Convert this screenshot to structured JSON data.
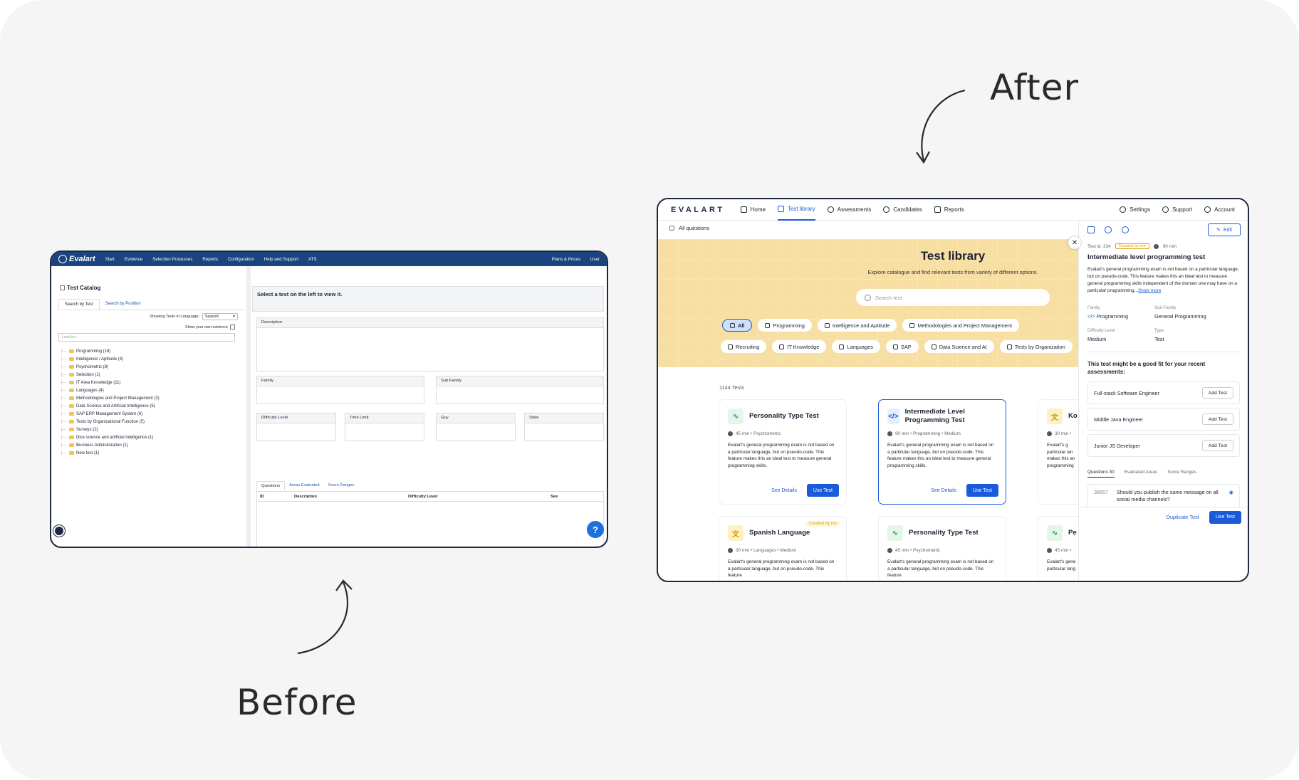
{
  "labels": {
    "after": "After",
    "before": "Before"
  },
  "before": {
    "nav": {
      "logo": "Evalart",
      "items": [
        "Start",
        "Evidence",
        "Selection Processes",
        "Reports",
        "Configuration",
        "Help and Support",
        "ATS"
      ],
      "right_items": [
        "Plans & Prices",
        "User"
      ]
    },
    "title": "Test Catalog",
    "tabs": [
      "Search by Test",
      "Search by Position"
    ],
    "language_label": "Showing Tests in Language:",
    "language_value": "Spanish",
    "own_evidence_label": "Show your own evidence",
    "look_for_placeholder": "Look for...",
    "tree": [
      "Programming (18)",
      "Intelligence / Aptitude (4)",
      "Psychometric (8)",
      "Selection (1)",
      "IT Area Knowledge (11)",
      "Languages (4)",
      "Methodologies and Project Management (3)",
      "Data Science and Artificial Intelligence (5)",
      "SAP ERP Management System (6)",
      "Tests by Organizational Function (5)",
      "Surveys (2)",
      "Dice science and artificial intelligence (1)",
      "Business Administration (1)",
      "New test (1)"
    ],
    "right_header": "Select a test on the left to view it.",
    "fields": {
      "description": "Description",
      "family": "Family",
      "sub_family": "Sub Family",
      "difficulty": "Difficulty Level",
      "time_limit": "Time Limit",
      "guy": "Guy",
      "state": "State"
    },
    "question_tabs": [
      "Questions",
      "Areas Evaluated",
      "Score Ranges"
    ],
    "table_headers": [
      "ID",
      "Description",
      "Difficulty Level",
      "See"
    ],
    "help": "?"
  },
  "after": {
    "nav": {
      "logo": "EVALART",
      "items": [
        "Home",
        "Test library",
        "Assessments",
        "Candidates",
        "Reports"
      ],
      "right_items": [
        "Settings",
        "Support",
        "Account"
      ]
    },
    "breadcrumb": "All questions",
    "hero": {
      "title": "Test library",
      "subtitle": "Explore catalogue and find relevant tests from variety of different options.",
      "search_placeholder": "Search test"
    },
    "chips_row1": [
      "All",
      "Programming",
      "Intelligence and Aptitude",
      "Methodologies and Project Management"
    ],
    "chips_row2": [
      "Recruiting",
      "IT Knowledge",
      "Languages",
      "SAP",
      "Data Science and AI",
      "Tests by Organization"
    ],
    "count": "1144 Tests",
    "cards": [
      {
        "title": "Personality Type Test",
        "meta": "45 min  •  Psychometric",
        "desc": "Evalart's general programming exam is not based on a particular language, but on pseudo-code. This feature makes this an ideal test to measure general programming skills.",
        "details": "See Details",
        "use": "Use Test"
      },
      {
        "title": "Intermediate Level Programming Test",
        "meta": "90 min  •  Programming  •  Medium",
        "desc": "Evalart's general programming exam is not based on a particular language, but on pseudo-code. This feature makes this an ideal test to measure general programming skills.",
        "details": "See Details",
        "use": "Use Test"
      },
      {
        "title": "Ko",
        "meta": "30 min  •",
        "desc": "Evalart's g particular lan makes this an programming"
      },
      {
        "title": "Spanish Language",
        "meta": "30 min  •  Languages  •  Medium",
        "desc": "Evalart's general programming exam is not based on a particular language, but on pseudo-code. This feature",
        "badge": "Created by me"
      },
      {
        "title": "Personality Type Test",
        "meta": "45 min  •  Psychometric",
        "desc": "Evalart's general programming exam is not based on a particular language, but on pseudo-code. This feature"
      },
      {
        "title": "Pe",
        "meta": "45 min  •",
        "desc": "Evalart's gene particular lang"
      }
    ],
    "panel": {
      "edit": "Edit",
      "test_id": "Test id: 334",
      "badge": "Created by me",
      "duration": "90 min",
      "title": "Intermediate level programming test",
      "desc": "Evalart's general programming exam is not based on a particular language, but on pseudo-code. This feature makes this an ideal test to measure general programming skills independent of the domain one may have on a particular programming...",
      "show_more": "Show more",
      "family_label": "Family",
      "family_value": "Programming",
      "subfamily_label": "Sub-Family",
      "subfamily_value": "General Programming",
      "difficulty_label": "Difficulty Level",
      "difficulty_value": "Medium",
      "type_label": "Type",
      "type_value": "Test",
      "fit_title": "This test might be a good fit for your recent assessments:",
      "roles": [
        "Full-stack Software Engineer",
        "Middle Java Engineer",
        "Junior JS Developer"
      ],
      "add_label": "Add Test",
      "tabs": [
        "Questions 30",
        "Evaluated Areas",
        "Score Ranges"
      ],
      "question_id": "38657",
      "question_text": "Should you publish the same message on all social media channels?",
      "duplicate": "Duplicate Test",
      "use": "Use Test"
    }
  }
}
